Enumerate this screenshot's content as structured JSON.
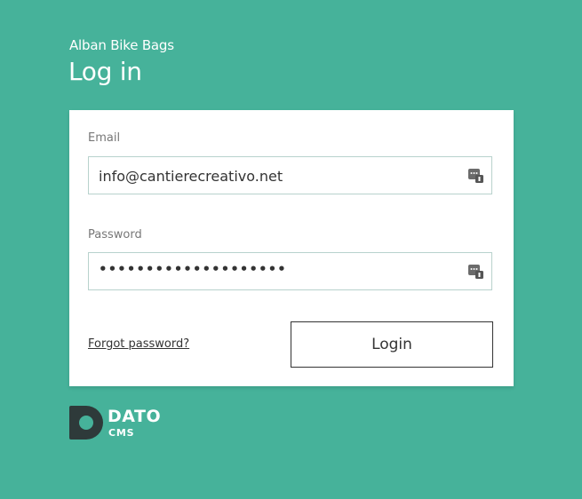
{
  "header": {
    "site_name": "Alban Bike Bags",
    "title": "Log in"
  },
  "form": {
    "email": {
      "label": "Email",
      "value": "info@cantierecreativo.net",
      "icon": "password-manager-icon"
    },
    "password": {
      "label": "Password",
      "value": "••••••••••••••••••••",
      "icon": "password-manager-icon"
    },
    "forgot_label": "Forgot password?",
    "login_label": "Login"
  },
  "footer": {
    "logo_brand": "DATO",
    "logo_sub": "CMS"
  },
  "colors": {
    "background": "#46b29a",
    "card": "#ffffff",
    "logo_dark": "#2e3a3a"
  }
}
